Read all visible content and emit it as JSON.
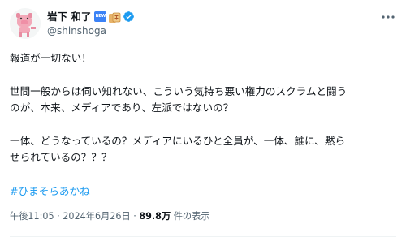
{
  "user": {
    "display_name": "岩下 和了",
    "new_badge": "NEW",
    "handle": "@shinshoga",
    "verified_color": "#1d9bf0"
  },
  "tweet": {
    "line1": "報道が一切ない！",
    "line2": "世間一般からは伺い知れない、こういう気持ち悪い権力のスクラムと闘う",
    "line3": "のが、本来、メディアであり、左派ではないの？",
    "line4": "一体、どうなっているの？メディアにいるひと全員が、一体、誰に、黙ら",
    "line5": "せられているの？？？",
    "hashtag": "#ひまそらあかね"
  },
  "meta": {
    "time": "午後11:05",
    "separator": " · ",
    "date": "2024年6月26日",
    "views_count": "89.8万",
    "views_label": " 件の表示"
  },
  "icons": {
    "more": "more-horizontal-icon",
    "verified": "verified-badge-icon"
  },
  "colors": {
    "link": "#1d9bf0",
    "secondary_text": "#536471",
    "primary_text": "#0f1419"
  }
}
